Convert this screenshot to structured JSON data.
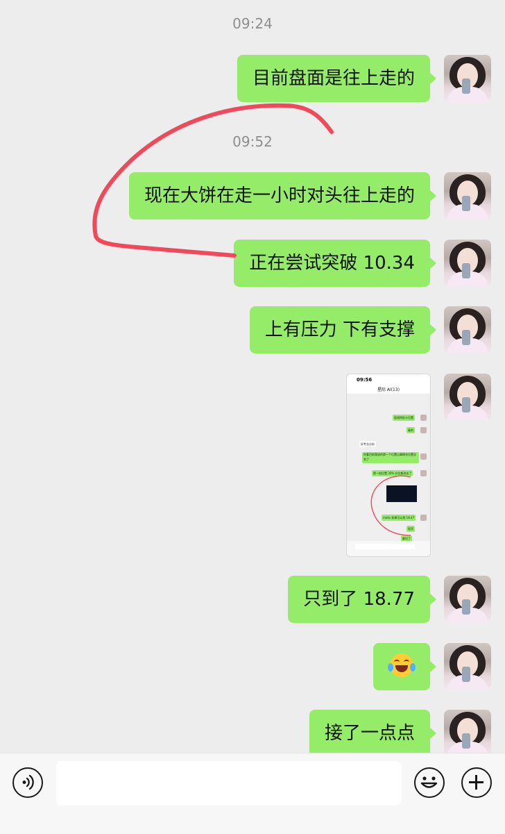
{
  "chat": {
    "timestamps": [
      "09:24",
      "09:52"
    ],
    "messages": [
      {
        "text": "目前盘面是往上走的"
      },
      {
        "text": "现在大饼在走一小时对头往上走的"
      },
      {
        "text": "正在尝试突破 10.34"
      },
      {
        "text": "上有压力 下有支撑"
      },
      {
        "type": "image",
        "description_icon": "chat-screenshot-thumbnail"
      },
      {
        "text": "只到了 18.77"
      },
      {
        "type": "emoji",
        "icon": "face-with-tears-of-joy-icon"
      },
      {
        "text": "接了一点点"
      }
    ]
  },
  "thumbnail": {
    "status_time": "09:56",
    "title": "星际 AI(13)",
    "bubbles": [
      "现线特别卡位置",
      "真的",
      "好专业分析",
      "你看目前我说的第一个位置山事情充位置全到了",
      "第一档位置 30% 仓位都进去了",
      "metis 如果可以到 18.47",
      "现货",
      "都拉了"
    ]
  },
  "colors": {
    "background": "#ededed",
    "bubble_green": "#95ec69",
    "timestamp_gray": "#8e8e8e",
    "annotation_red": "#f0495a",
    "input_bar": "#f7f7f7"
  },
  "input_bar": {
    "voice_icon": "voice-icon",
    "emoji_icon": "emoji-icon",
    "plus_icon": "plus-icon",
    "text_value": ""
  }
}
